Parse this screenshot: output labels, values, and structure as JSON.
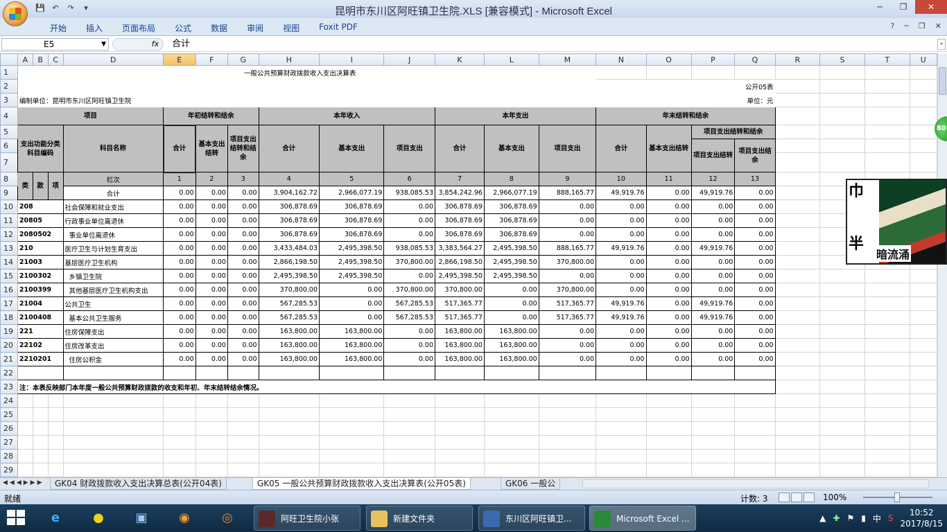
{
  "window": {
    "title": "昆明市东川区阿旺镇卫生院.XLS  [兼容模式] - Microsoft Excel",
    "min": "─",
    "restore": "❐",
    "close": "✕"
  },
  "ribbon": {
    "tabs": [
      "开始",
      "插入",
      "页面布局",
      "公式",
      "数据",
      "审阅",
      "视图",
      "Foxit PDF"
    ],
    "help": "?",
    "min": "─",
    "restore": "❐",
    "close": "✕"
  },
  "formula_bar": {
    "name_box": "E5",
    "fx": "fx",
    "content": "合计"
  },
  "columns": [
    "A",
    "B",
    "C",
    "D",
    "E",
    "F",
    "G",
    "H",
    "I",
    "J",
    "K",
    "L",
    "M",
    "N",
    "O",
    "P",
    "Q",
    "R",
    "S",
    "T",
    "U"
  ],
  "sheet": {
    "title": "一般公共预算财政拨款收入支出决算表",
    "form_no": "公开05表",
    "unit_label": "编制单位：昆明市东川区阿旺镇卫生院",
    "unit": "单位：元",
    "h_item": "项目",
    "h_begin": "年初结转和结余",
    "h_income": "本年收入",
    "h_expense": "本年支出",
    "h_end": "年末结转和结余",
    "h_func_code": "支出功能分类科目编码",
    "h_subject": "科目名称",
    "h_total": "合计",
    "h_basic": "基本支出结转",
    "h_project": "项目支出结转和结余",
    "h_basic_exp": "基本支出",
    "h_proj_exp": "项目支出",
    "h_end_basic": "基本支出结转",
    "h_end_proj": "项目支出结转和结余",
    "h_end_proj_carry": "项目支出结转",
    "h_end_proj_bal": "项目支出结余",
    "h_lei": "类",
    "h_kuan": "款",
    "h_xiang": "项",
    "h_lanci": "栏次",
    "col_nums": [
      "1",
      "2",
      "3",
      "4",
      "5",
      "6",
      "7",
      "8",
      "9",
      "10",
      "11",
      "12",
      "13"
    ],
    "total_label": "合计",
    "totals": [
      "0.00",
      "0.00",
      "0.00",
      "3,904,162.72",
      "2,966,077.19",
      "938,085.53",
      "3,854,242.96",
      "2,966,077.19",
      "888,165.77",
      "49,919.76",
      "0.00",
      "49,919.76",
      "0.00"
    ],
    "rows": [
      {
        "code": "208",
        "name": "社会保障和就业支出",
        "v": [
          "0.00",
          "0.00",
          "0.00",
          "306,878.69",
          "306,878.69",
          "0.00",
          "306,878.69",
          "306,878.69",
          "0.00",
          "0.00",
          "0.00",
          "0.00",
          "0.00"
        ]
      },
      {
        "code": "20805",
        "name": "行政事业单位离退休",
        "v": [
          "0.00",
          "0.00",
          "0.00",
          "306,878.69",
          "306,878.69",
          "0.00",
          "306,878.69",
          "306,878.69",
          "0.00",
          "0.00",
          "0.00",
          "0.00",
          "0.00"
        ]
      },
      {
        "code": "2080502",
        "name": "  事业单位离退休",
        "v": [
          "0.00",
          "0.00",
          "0.00",
          "306,878.69",
          "306,878.69",
          "0.00",
          "306,878.69",
          "306,878.69",
          "0.00",
          "0.00",
          "0.00",
          "0.00",
          "0.00"
        ]
      },
      {
        "code": "210",
        "name": "医疗卫生与计划生育支出",
        "v": [
          "0.00",
          "0.00",
          "0.00",
          "3,433,484.03",
          "2,495,398.50",
          "938,085.53",
          "3,383,564.27",
          "2,495,398.50",
          "888,165.77",
          "49,919.76",
          "0.00",
          "49,919.76",
          "0.00"
        ]
      },
      {
        "code": "21003",
        "name": "基层医疗卫生机构",
        "v": [
          "0.00",
          "0.00",
          "0.00",
          "2,866,198.50",
          "2,495,398.50",
          "370,800.00",
          "2,866,198.50",
          "2,495,398.50",
          "370,800.00",
          "0.00",
          "0.00",
          "0.00",
          "0.00"
        ]
      },
      {
        "code": "2100302",
        "name": "  乡镇卫生院",
        "v": [
          "0.00",
          "0.00",
          "0.00",
          "2,495,398.50",
          "2,495,398.50",
          "0.00",
          "2,495,398.50",
          "2,495,398.50",
          "0.00",
          "0.00",
          "0.00",
          "0.00",
          "0.00"
        ]
      },
      {
        "code": "2100399",
        "name": "  其他基层医疗卫生机构支出",
        "v": [
          "0.00",
          "0.00",
          "0.00",
          "370,800.00",
          "0.00",
          "370,800.00",
          "370,800.00",
          "0.00",
          "370,800.00",
          "0.00",
          "0.00",
          "0.00",
          "0.00"
        ]
      },
      {
        "code": "21004",
        "name": "公共卫生",
        "v": [
          "0.00",
          "0.00",
          "0.00",
          "567,285.53",
          "0.00",
          "567,285.53",
          "517,365.77",
          "0.00",
          "517,365.77",
          "49,919.76",
          "0.00",
          "49,919.76",
          "0.00"
        ]
      },
      {
        "code": "2100408",
        "name": "  基本公共卫生服务",
        "v": [
          "0.00",
          "0.00",
          "0.00",
          "567,285.53",
          "0.00",
          "567,285.53",
          "517,365.77",
          "0.00",
          "517,365.77",
          "49,919.76",
          "0.00",
          "49,919.76",
          "0.00"
        ]
      },
      {
        "code": "221",
        "name": "住房保障支出",
        "v": [
          "0.00",
          "0.00",
          "0.00",
          "163,800.00",
          "163,800.00",
          "0.00",
          "163,800.00",
          "163,800.00",
          "0.00",
          "0.00",
          "0.00",
          "0.00",
          "0.00"
        ]
      },
      {
        "code": "22102",
        "name": "住房改革支出",
        "v": [
          "0.00",
          "0.00",
          "0.00",
          "163,800.00",
          "163,800.00",
          "0.00",
          "163,800.00",
          "163,800.00",
          "0.00",
          "0.00",
          "0.00",
          "0.00",
          "0.00"
        ]
      },
      {
        "code": "2210201",
        "name": "  住房公积金",
        "v": [
          "0.00",
          "0.00",
          "0.00",
          "163,800.00",
          "163,800.00",
          "0.00",
          "163,800.00",
          "163,800.00",
          "0.00",
          "0.00",
          "0.00",
          "0.00",
          "0.00"
        ]
      }
    ],
    "note": "注：本表反映部门本年度一般公共预算财政拨款的收支和年初、年末结转结余情况。"
  },
  "sheet_tabs": [
    {
      "label": "GK04 财政拨款收入支出决算总表(公开04表)",
      "active": false
    },
    {
      "label": "GK05 一般公共预算财政拨款收入支出决算表(公开05表)",
      "active": true
    },
    {
      "label": "GK06 一般公",
      "active": false
    }
  ],
  "status": {
    "ready": "就绪",
    "count": "计数: 3",
    "zoom": "100%"
  },
  "sticker": {
    "text_a": "巾",
    "text_b": "半",
    "caption": "暗流涌"
  },
  "green_badge": "80",
  "taskbar": {
    "tasks": [
      {
        "label": "阿旺卫生院小张",
        "active": false
      },
      {
        "label": "新建文件夹",
        "active": false
      },
      {
        "label": "东川区阿旺镇卫...",
        "active": false
      },
      {
        "label": "Microsoft Excel ...",
        "active": true
      }
    ],
    "ime": "中",
    "time": "10:52",
    "date": "2017/8/15"
  }
}
